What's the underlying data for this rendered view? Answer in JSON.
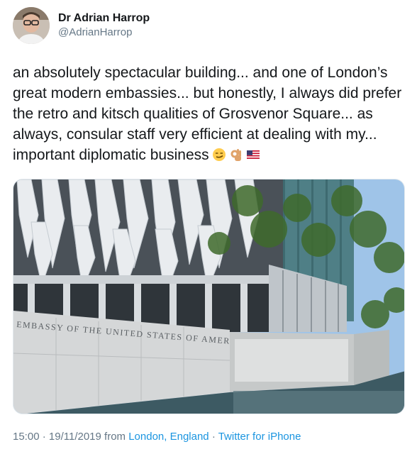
{
  "author": {
    "display_name": "Dr Adrian Harrop",
    "handle": "@AdrianHarrop"
  },
  "tweet": {
    "text": "an absolutely spectacular building... and one of London’s great modern embassies... but honestly, I always did prefer the retro and kitsch qualities of Grosvenor Square... as always, consular staff very efficient at dealing with my... important diplomatic business",
    "emojis": [
      "smirking-face-emoji",
      "ok-hand-emoji",
      "us-flag-emoji"
    ]
  },
  "photo": {
    "sign_text": "EMBASSY OF THE UNITED STATES OF AMERICA"
  },
  "meta": {
    "time": "15:00",
    "date": "19/11/2019",
    "from_label": "from",
    "location": "London, England",
    "separator": "·",
    "client": "Twitter for iPhone"
  },
  "colors": {
    "link": "#1b95e0",
    "secondary_text": "#657786"
  }
}
